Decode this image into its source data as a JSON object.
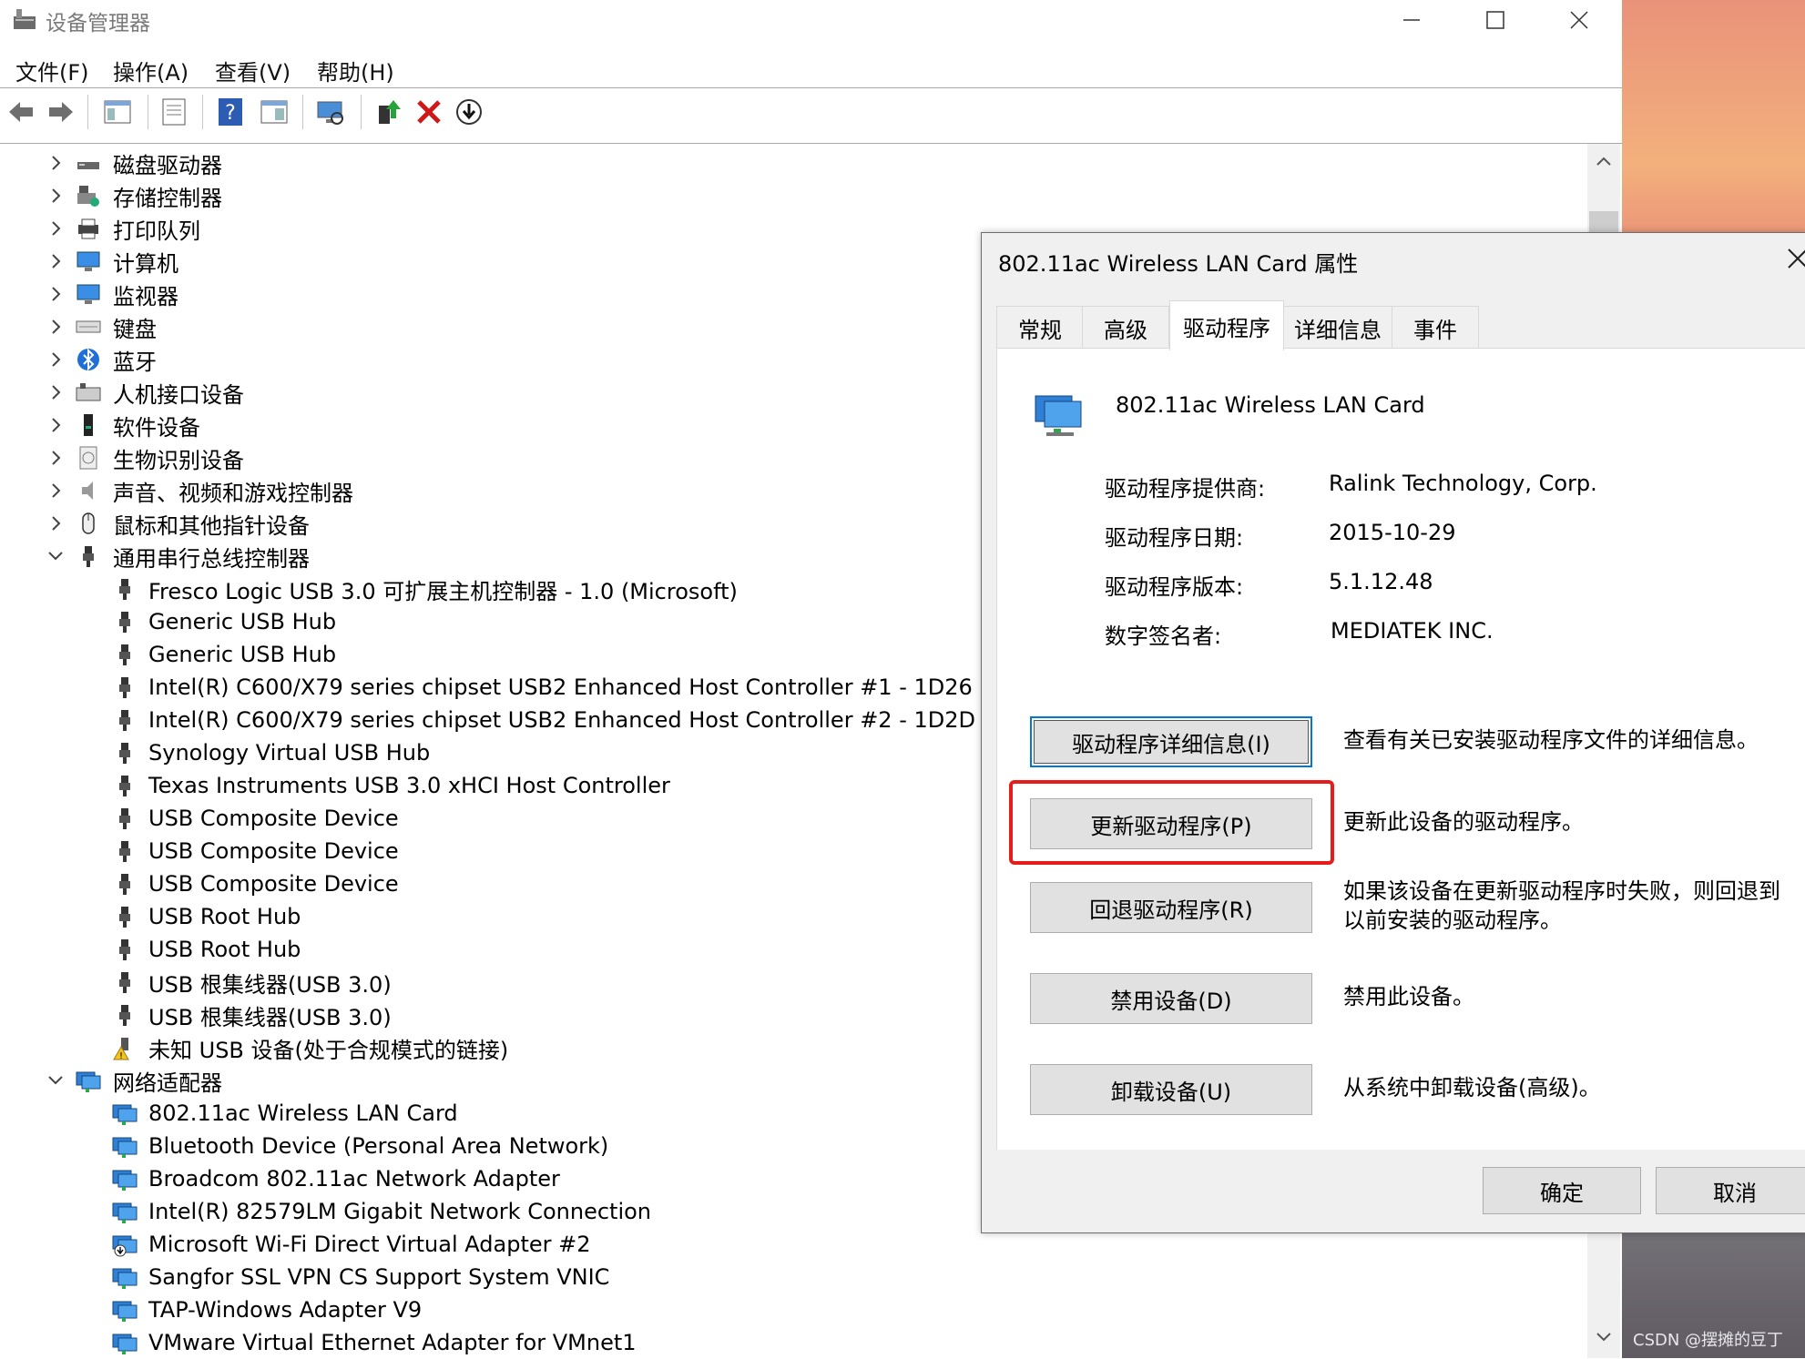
{
  "window": {
    "title": "设备管理器",
    "minimize_icon": "minimize-icon",
    "maximize_icon": "maximize-icon",
    "close_icon": "close-icon"
  },
  "menu": [
    "文件(F)",
    "操作(A)",
    "查看(V)",
    "帮助(H)"
  ],
  "toolbar": {
    "icons": [
      "back-arrow-icon",
      "forward-arrow-icon",
      "show-hide-tree-icon",
      "properties-icon",
      "help-icon",
      "view-action-icon",
      "scan-hardware-icon",
      "update-driver-icon",
      "uninstall-icon",
      "disable-device-icon"
    ]
  },
  "tree": {
    "categories": [
      {
        "label": "磁盘驱动器",
        "icon": "disk-drive-icon",
        "expanded": false
      },
      {
        "label": "存储控制器",
        "icon": "storage-controller-icon",
        "expanded": false
      },
      {
        "label": "打印队列",
        "icon": "printer-icon",
        "expanded": false
      },
      {
        "label": "计算机",
        "icon": "computer-icon",
        "expanded": false
      },
      {
        "label": "监视器",
        "icon": "monitor-icon",
        "expanded": false
      },
      {
        "label": "键盘",
        "icon": "keyboard-icon",
        "expanded": false
      },
      {
        "label": "蓝牙",
        "icon": "bluetooth-icon",
        "expanded": false
      },
      {
        "label": "人机接口设备",
        "icon": "hid-icon",
        "expanded": false
      },
      {
        "label": "软件设备",
        "icon": "software-device-icon",
        "expanded": false
      },
      {
        "label": "生物识别设备",
        "icon": "biometric-icon",
        "expanded": false
      },
      {
        "label": "声音、视频和游戏控制器",
        "icon": "speaker-icon",
        "expanded": false
      },
      {
        "label": "鼠标和其他指针设备",
        "icon": "mouse-icon",
        "expanded": false
      },
      {
        "label": "通用串行总线控制器",
        "icon": "usb-icon",
        "expanded": true
      }
    ],
    "usb_children": [
      "Fresco Logic USB 3.0 可扩展主机控制器 - 1.0 (Microsoft)",
      "Generic USB Hub",
      "Generic USB Hub",
      "Intel(R) C600/X79 series chipset USB2 Enhanced Host Controller #1 - 1D26",
      "Intel(R) C600/X79 series chipset USB2 Enhanced Host Controller #2 - 1D2D",
      "Synology Virtual USB Hub",
      "Texas Instruments USB 3.0 xHCI Host Controller",
      "USB Composite Device",
      "USB Composite Device",
      "USB Composite Device",
      "USB Root Hub",
      "USB Root Hub",
      "USB 根集线器(USB 3.0)",
      "USB 根集线器(USB 3.0)",
      "未知 USB 设备(处于合规模式的链接)"
    ],
    "network_category": {
      "label": "网络适配器",
      "icon": "network-adapter-icon",
      "expanded": true
    },
    "network_children": [
      "802.11ac Wireless LAN Card",
      "Bluetooth Device (Personal Area Network)",
      "Broadcom 802.11ac Network Adapter",
      "Intel(R) 82579LM Gigabit Network Connection",
      "Microsoft Wi-Fi Direct Virtual Adapter #2",
      "Sangfor SSL VPN CS Support System VNIC",
      "TAP-Windows Adapter V9",
      "VMware Virtual Ethernet Adapter for VMnet1"
    ]
  },
  "dialog": {
    "title": "802.11ac Wireless LAN Card 属性",
    "tabs": [
      "常规",
      "高级",
      "驱动程序",
      "详细信息",
      "事件"
    ],
    "active_tab": "驱动程序",
    "device_name": "802.11ac Wireless LAN Card",
    "fields": [
      {
        "label": "驱动程序提供商:",
        "value": "Ralink Technology, Corp."
      },
      {
        "label": "驱动程序日期:",
        "value": "2015-10-29"
      },
      {
        "label": "驱动程序版本:",
        "value": "5.1.12.48"
      },
      {
        "label": "数字签名者:",
        "value": "MEDIATEK INC."
      }
    ],
    "actions": [
      {
        "button": "驱动程序详细信息(I)",
        "desc": "查看有关已安装驱动程序文件的详细信息。"
      },
      {
        "button": "更新驱动程序(P)",
        "desc": "更新此设备的驱动程序。"
      },
      {
        "button": "回退驱动程序(R)",
        "desc": "如果该设备在更新驱动程序时失败，则回退到以前安装的驱动程序。"
      },
      {
        "button": "禁用设备(D)",
        "desc": "禁用此设备。"
      },
      {
        "button": "卸载设备(U)",
        "desc": "从系统中卸载设备(高级)。"
      }
    ],
    "ok_label": "确定",
    "cancel_label": "取消",
    "highlight_color": "#e61c1c"
  },
  "watermark": "CSDN @摆摊的豆丁"
}
